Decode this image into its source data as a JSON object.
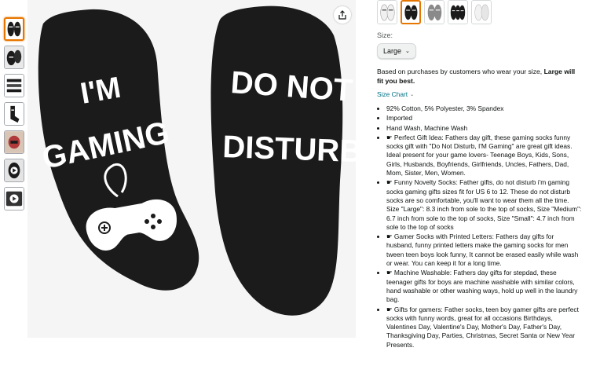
{
  "thumbnails": [
    {
      "name": "socks-thumb-1",
      "active": true
    },
    {
      "name": "socks-thumb-2",
      "active": false
    },
    {
      "name": "socks-thumb-3",
      "active": false
    },
    {
      "name": "socks-thumb-4",
      "active": false
    },
    {
      "name": "socks-thumb-5",
      "active": false
    },
    {
      "name": "socks-thumb-6",
      "active": false
    },
    {
      "name": "video-thumb",
      "active": false
    }
  ],
  "main_image": {
    "left_sock_text": [
      "I'M",
      "GAMING"
    ],
    "right_sock_text": [
      "DO NOT",
      "DISTURB"
    ]
  },
  "variants": [
    "white",
    "black",
    "grey",
    "black-pair",
    "white-pair"
  ],
  "size": {
    "label": "Size:",
    "selected": "Large"
  },
  "fit_note": {
    "prefix": "Based on purchases by customers who wear your size, ",
    "bold": "Large will fit you best."
  },
  "size_chart_label": "Size Chart",
  "bullets": [
    "92% Cotton, 5% Polyester, 3% Spandex",
    "Imported",
    "Hand Wash, Machine Wash",
    "☛ Perfect Gift Idea: Fathers day gift, these gaming socks funny socks gift with \"Do Not Disturb, I'M Gaming\" are great gift ideas. Ideal present for your game lovers- Teenage Boys, Kids, Sons, Girls, Husbands, Boyfriends, Girlfriends, Uncles, Fathers, Dad, Mom, Sister, Men, Women.",
    "☛ Funny Novelty Socks: Father gifts, do not disturb i'm gaming socks gaming gifts sizes fit for US 6 to 12. These do not disturb socks are so comfortable, you'll want to wear them all the time. Size \"Large\": 8.3 inch from sole to the top of socks, Size \"Medium\": 6.7 inch from sole to the top of socks, Size \"Small\": 4.7 inch from sole to the top of socks",
    "☛ Gamer Socks with Printed Letters: Fathers day gifts for husband, funny printed letters make the gaming socks for men tween teen boys look funny, It cannot be erased easily while wash or wear. You can keep it for a long time.",
    "☛ Machine Washable: Fathers day gifts for stepdad, these teenager gifts for boys are machine washable with similar colors, hand washable or other washing ways, hold up well in the laundry bag.",
    "☛ Gifts for gamers: Father socks, teen boy gamer gifts are perfect socks with funny words, great for all occasions Birthdays, Valentines Day, Valentine's Day, Mother's Day, Father's Day, Thanksgiving Day, Parties, Christmas, Secret Santa or New Year Presents."
  ],
  "colors": {
    "accent": "#e77600",
    "link": "#007185",
    "sock": "#1b1b1b"
  }
}
